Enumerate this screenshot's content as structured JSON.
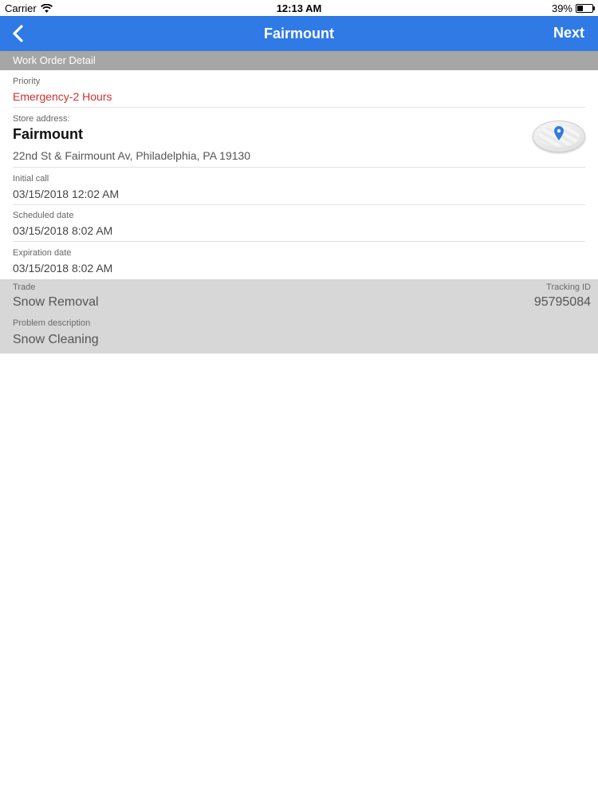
{
  "status_bar": {
    "carrier": "Carrier",
    "time": "12:13 AM",
    "battery_text": "39%",
    "battery_level": 0.39
  },
  "nav": {
    "title": "Fairmount",
    "next_label": "Next",
    "color": "#2f7ae5"
  },
  "section": {
    "title": "Work Order Detail"
  },
  "priority": {
    "label": "Priority",
    "value": "Emergency-2 Hours",
    "color": "#d32f2f"
  },
  "store": {
    "label": "Store address:",
    "name": "Fairmount",
    "address": "22nd St & Fairmount Av, Philadelphia, PA 19130",
    "map_icon": "map-pin-icon"
  },
  "initial_call": {
    "label": "Initial call",
    "value": "03/15/2018 12:02 AM"
  },
  "scheduled": {
    "label": "Scheduled date",
    "value": "03/15/2018 8:02 AM"
  },
  "expiration": {
    "label": "Expiration date",
    "value": "03/15/2018 8:02 AM"
  },
  "trade": {
    "label": "Trade",
    "value": "Snow Removal"
  },
  "tracking": {
    "label": "Tracking ID",
    "value": "95795084"
  },
  "problem": {
    "label": "Problem description",
    "value": "Snow Cleaning"
  }
}
